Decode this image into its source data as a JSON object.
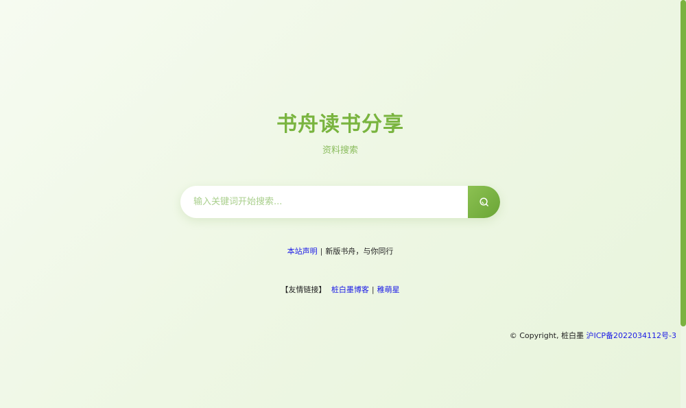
{
  "header": {
    "title": "书舟读书分享",
    "subtitle": "资料搜索"
  },
  "search": {
    "placeholder": "输入关键词开始搜索...",
    "value": "",
    "button_icon": "search-icon"
  },
  "notice": {
    "link_label": "本站声明",
    "separator": "|",
    "text": "新版书舟，与你同行"
  },
  "friends": {
    "label": "【友情链接】",
    "links": [
      {
        "label": "桩白墨博客"
      },
      {
        "label": "稚萌星"
      }
    ],
    "separator": "|"
  },
  "footer": {
    "copyright": "© Copyright, 桩白墨",
    "icp_link": "沪ICP备2022034112号-3"
  },
  "colors": {
    "accent": "#79b43f",
    "link": "#1a1ae6",
    "background": "#eef7e4"
  }
}
